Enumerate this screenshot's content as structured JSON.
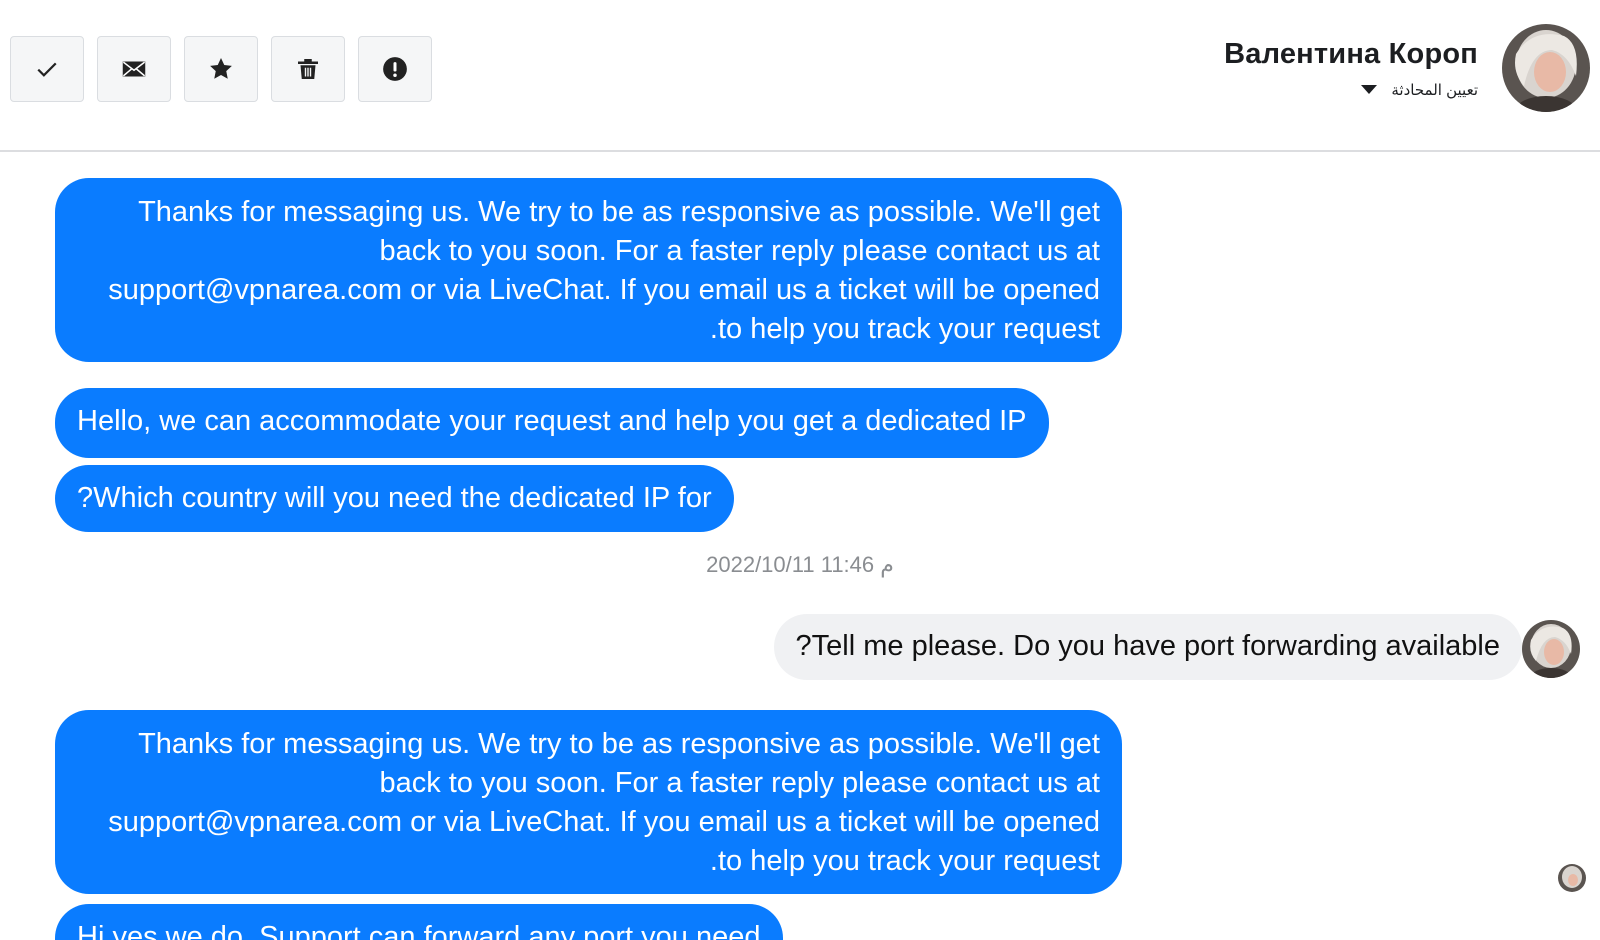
{
  "header": {
    "toolbar": [
      {
        "name": "mark-done-button",
        "icon": "check-icon"
      },
      {
        "name": "mark-unread-button",
        "icon": "envelope-icon"
      },
      {
        "name": "star-button",
        "icon": "star-icon"
      },
      {
        "name": "delete-button",
        "icon": "trash-icon"
      },
      {
        "name": "report-button",
        "icon": "alert-icon"
      }
    ],
    "contact_name": "Валентина Короп",
    "assign_label": "تعيين المحادثة"
  },
  "thread": {
    "messages": [
      {
        "id": "m1",
        "direction": "outgoing",
        "text": "Thanks for messaging us. We try to be as responsive as possible. We'll get back to you soon. For a faster reply please contact us at support@vpnarea.com or via LiveChat. If you email us a ticket will be opened .to help you track your request"
      },
      {
        "id": "m2",
        "direction": "outgoing",
        "text": "Hello, we can accommodate your request and help you get a dedicated IP"
      },
      {
        "id": "m3",
        "direction": "outgoing",
        "text": "?Which country will you need the dedicated IP for"
      },
      {
        "id": "m4",
        "direction": "incoming",
        "text": "?Tell me please. Do you have port forwarding available"
      },
      {
        "id": "m5",
        "direction": "outgoing",
        "text": "Thanks for messaging us. We try to be as responsive as possible. We'll get back to you soon. For a faster reply please contact us at support@vpnarea.com or via LiveChat. If you email us a ticket will be opened .to help you track your request"
      },
      {
        "id": "m6",
        "direction": "outgoing",
        "text": "Hi yes we do. Support can forward any port you need"
      }
    ],
    "timestamp": "2022/10/11 11:46 م"
  },
  "colors": {
    "outgoing_bubble": "#0a7cff",
    "incoming_bubble": "#f0f1f3",
    "timestamp_text": "#8a8d91"
  }
}
